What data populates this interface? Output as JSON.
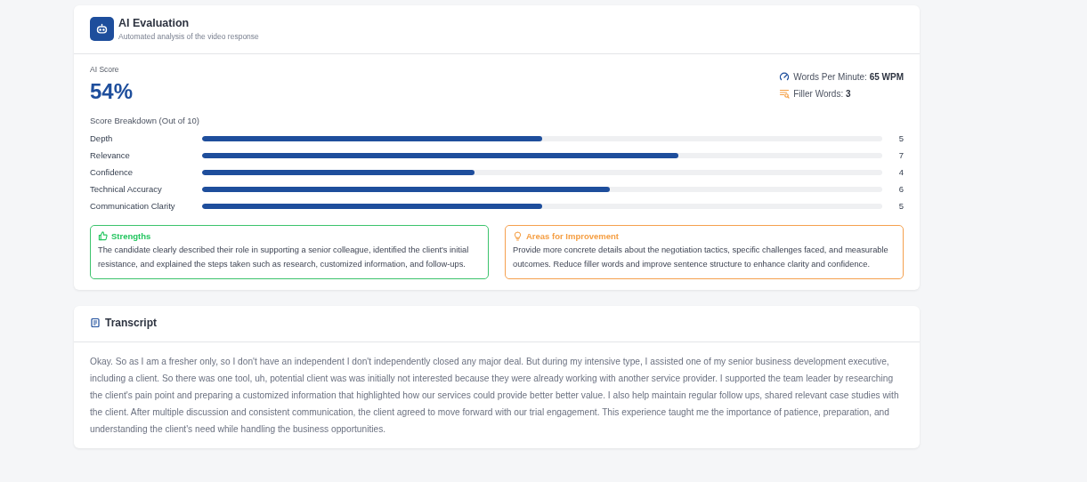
{
  "evaluation": {
    "title": "AI Evaluation",
    "subtitle": "Automated analysis of the video response",
    "score_label": "AI Score",
    "score": "54%",
    "metrics": [
      {
        "label": "Words Per Minute:",
        "value": "65 WPM",
        "kind": "speed"
      },
      {
        "label": "Filler Words:",
        "value": "3",
        "kind": "filler"
      }
    ],
    "breakdown_title": "Score Breakdown (Out of 10)",
    "breakdown": [
      {
        "label": "Depth",
        "level": 0.5,
        "value": "5"
      },
      {
        "label": "Relevance",
        "level": 0.7,
        "value": "7"
      },
      {
        "label": "Confidence",
        "level": 0.4,
        "value": "4"
      },
      {
        "label": "Technical Accuracy",
        "level": 0.6,
        "value": "6"
      },
      {
        "label": "Communication Clarity",
        "level": 0.5,
        "value": "5"
      }
    ],
    "feedback": [
      {
        "kind": "strengths",
        "title": "Strengths",
        "text": "The candidate clearly described their role in supporting a senior colleague, identified the client's initial resistance, and explained the steps taken such as research, customized information, and follow-ups."
      },
      {
        "kind": "improvement",
        "title": "Areas for Improvement",
        "text": "Provide more concrete details about the negotiation tactics, specific challenges faced, and measurable outcomes. Reduce filler words and improve sentence structure to enhance clarity and confidence."
      }
    ]
  },
  "transcript": {
    "title": "Transcript",
    "text": "Okay. So as I am a fresher only, so I don't have an independent I don't independently closed any major deal. But during my intensive type, I assisted one of my senior business development executive, including a client. So there was one tool, uh, potential client was was initially not interested because they were already working with another service provider. I supported the team leader by researching the client's pain point and preparing a customized information that highlighted how our services could provide better better value. I also help maintain regular follow ups, shared relevant case studies with the client. After multiple discussion and consistent communication, the client agreed to move forward with our trial engagement. This experience taught me the importance of patience, preparation, and understanding the client's need while handling the business opportunities."
  }
}
